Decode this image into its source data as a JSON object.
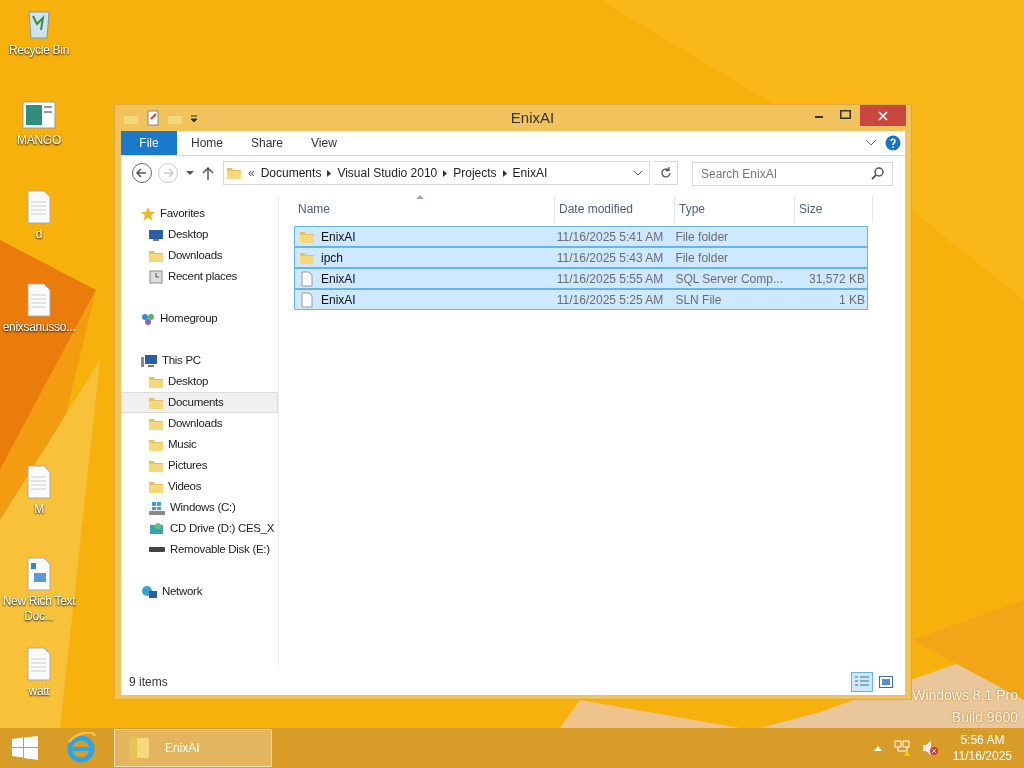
{
  "desktop": {
    "icons": [
      {
        "label": "Recycle Bin",
        "kind": "recycle"
      },
      {
        "label": "MANGO",
        "kind": "app"
      },
      {
        "label": "d",
        "kind": "doc"
      },
      {
        "label": "enixsanusso...",
        "kind": "doc"
      },
      {
        "label": "M",
        "kind": "doc"
      },
      {
        "label": "New Rich Text Doc...",
        "kind": "rtf"
      },
      {
        "label": "watt",
        "kind": "doc"
      }
    ],
    "watermark": [
      "Windows 8.1 Pro",
      "Build 9600"
    ]
  },
  "window": {
    "title": "EnixAI",
    "ribbon_tabs": [
      {
        "label": "File",
        "kind": "file"
      },
      {
        "label": "Home",
        "kind": "tab"
      },
      {
        "label": "Share",
        "kind": "tab"
      },
      {
        "label": "View",
        "kind": "tab"
      }
    ],
    "address": {
      "overflow": "«",
      "crumbs": [
        "Documents",
        "Visual Studio 2010",
        "Projects",
        "EnixAI"
      ]
    },
    "search": {
      "placeholder": "Search EnixAI"
    },
    "nav": [
      {
        "label": "Favorites",
        "kind": "star",
        "selected": false,
        "children": [
          {
            "label": "Desktop",
            "kind": "desktop",
            "selected": false
          },
          {
            "label": "Downloads",
            "kind": "folder",
            "selected": false
          },
          {
            "label": "Recent places",
            "kind": "recent",
            "selected": false
          }
        ]
      },
      {
        "label": "Homegroup",
        "kind": "homegroup",
        "selected": false
      },
      {
        "label": "This PC",
        "kind": "pc",
        "selected": false,
        "children": [
          {
            "label": "Desktop",
            "kind": "folder",
            "selected": false
          },
          {
            "label": "Documents",
            "kind": "folder",
            "selected": true
          },
          {
            "label": "Downloads",
            "kind": "folder",
            "selected": false
          },
          {
            "label": "Music",
            "kind": "folder",
            "selected": false
          },
          {
            "label": "Pictures",
            "kind": "folder",
            "selected": false
          },
          {
            "label": "Videos",
            "kind": "folder",
            "selected": false
          },
          {
            "label": "Windows (C:)",
            "kind": "drive",
            "selected": false
          },
          {
            "label": "CD Drive (D:) CES_X",
            "kind": "cd",
            "selected": false
          },
          {
            "label": "Removable Disk (E:)",
            "kind": "usb",
            "selected": false
          }
        ]
      },
      {
        "label": "Network",
        "kind": "network",
        "selected": false
      }
    ],
    "columns": [
      "Name",
      "Date modified",
      "Type",
      "Size"
    ],
    "rows": [
      {
        "name": "EnixAI",
        "date": "11/16/2025 5:41 AM",
        "type": "File folder",
        "kind": "folder",
        "selected": true
      },
      {
        "name": "ipch",
        "date": "11/16/2025 5:43 AM",
        "type": "File folder",
        "kind": "folder",
        "selected": true
      },
      {
        "name": "EnixAI",
        "date": "11/16/2025 5:55 AM",
        "type": "SQL Server Comp...",
        "size": "31,572 KB",
        "kind": "file",
        "selected": true
      },
      {
        "name": "EnixAI",
        "date": "11/16/2025 5:25 AM",
        "type": "SLN File",
        "size": "1 KB",
        "kind": "file",
        "selected": true
      }
    ],
    "status": "9 items",
    "views": [
      {
        "kind": "details",
        "selected": true
      },
      {
        "kind": "large",
        "selected": false
      }
    ]
  },
  "taskbar": {
    "apps": [
      {
        "kind": "ie"
      },
      {
        "kind": "explorer",
        "label": "EnixAI",
        "selected": true
      }
    ],
    "clock": {
      "time": "5:56 AM",
      "date": "11/16/2025"
    }
  }
}
